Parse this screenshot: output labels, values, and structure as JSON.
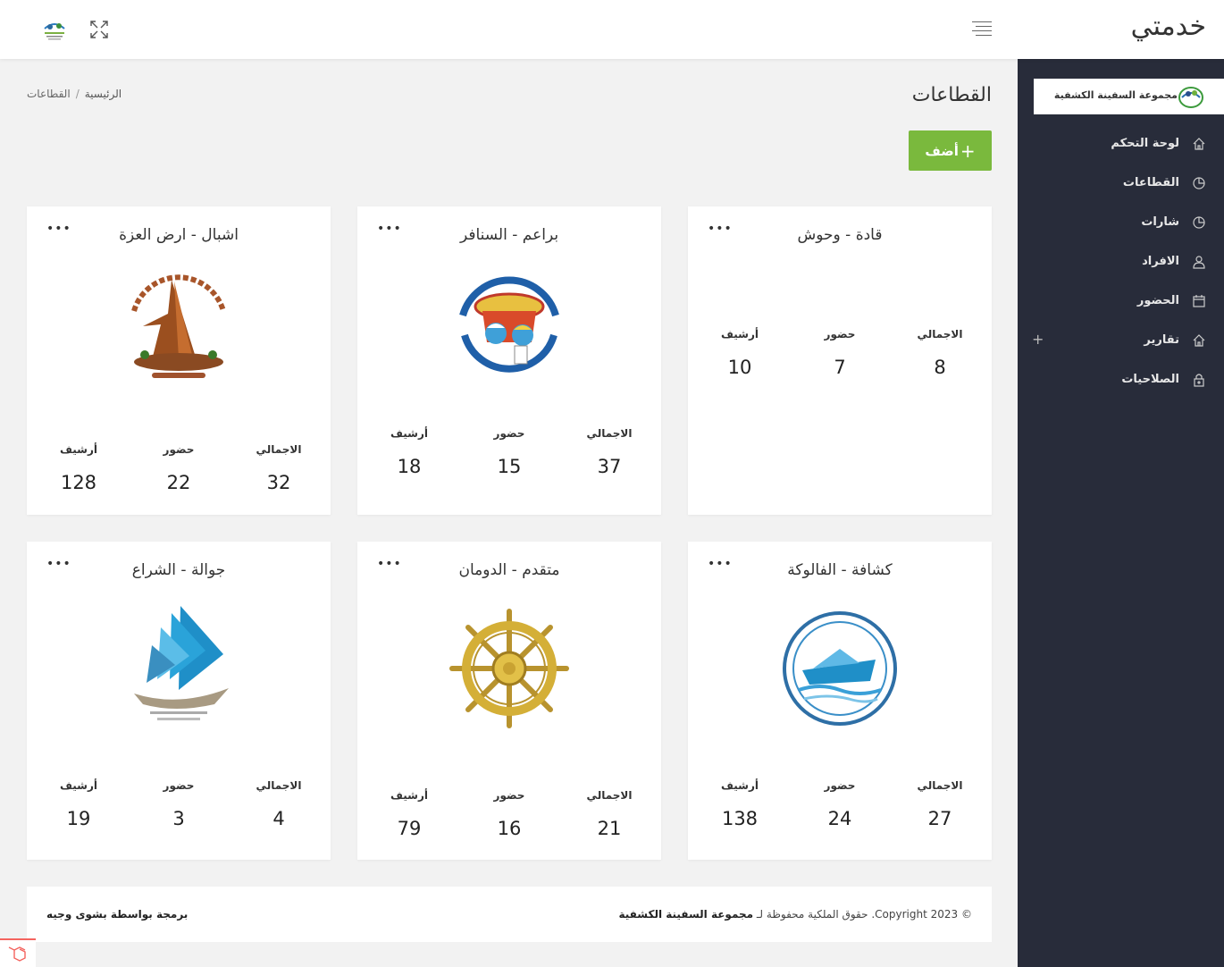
{
  "header": {
    "brand": "خدمتي"
  },
  "sidebar": {
    "logo_text": "مجموعة السفينة الكشفية",
    "items": [
      {
        "label": "لوحة التحكم",
        "icon": "home-icon"
      },
      {
        "label": "القطاعات",
        "icon": "pie-chart-icon"
      },
      {
        "label": "شارات",
        "icon": "pie-chart-icon"
      },
      {
        "label": "الافراد",
        "icon": "user-icon"
      },
      {
        "label": "الحضور",
        "icon": "calendar-icon"
      },
      {
        "label": "تقارير",
        "icon": "home-icon",
        "expandable": "+"
      },
      {
        "label": "الصلاحيات",
        "icon": "lock-icon"
      }
    ]
  },
  "page": {
    "title": "القطاعات",
    "breadcrumb": {
      "home": "الرئيسية",
      "separator": "/",
      "current": "القطاعات"
    },
    "add_button": "أضف",
    "add_icon": "+"
  },
  "sectors": [
    {
      "title": "قادة - وحوش",
      "has_logo": false,
      "labels": [
        "الاجمالي",
        "حضور",
        "أرشيف"
      ],
      "values": [
        "8",
        "7",
        "10"
      ],
      "menu": "•••"
    },
    {
      "title": "براعم - السنافر",
      "has_logo": true,
      "logo": "smurfs-logo",
      "labels": [
        "الاجمالي",
        "حضور",
        "أرشيف"
      ],
      "values": [
        "37",
        "15",
        "18"
      ],
      "menu": "•••"
    },
    {
      "title": "اشبال - ارض العزة",
      "has_logo": true,
      "logo": "rock-logo",
      "labels": [
        "الاجمالي",
        "حضور",
        "أرشيف"
      ],
      "values": [
        "32",
        "22",
        "128"
      ],
      "menu": "•••"
    },
    {
      "title": "كشافة - الفالوكة",
      "has_logo": true,
      "logo": "boat-logo",
      "labels": [
        "الاجمالي",
        "حضور",
        "أرشيف"
      ],
      "values": [
        "27",
        "24",
        "138"
      ],
      "menu": "•••"
    },
    {
      "title": "متقدم - الدومان",
      "has_logo": true,
      "logo": "helm-logo",
      "labels": [
        "الاجمالي",
        "حضور",
        "أرشيف"
      ],
      "values": [
        "21",
        "16",
        "79"
      ],
      "menu": "•••"
    },
    {
      "title": "جوالة - الشراع",
      "has_logo": true,
      "logo": "sail-logo",
      "labels": [
        "الاجمالي",
        "حضور",
        "أرشيف"
      ],
      "values": [
        "4",
        "3",
        "19"
      ],
      "menu": "•••"
    }
  ],
  "footer": {
    "copyright": "© Copyright 2023. حقوق الملكية محفوظة لـ",
    "owner": "مجموعة السفينة الكشفية",
    "credit": "برمجة بواسطة بشوى وجيه"
  }
}
